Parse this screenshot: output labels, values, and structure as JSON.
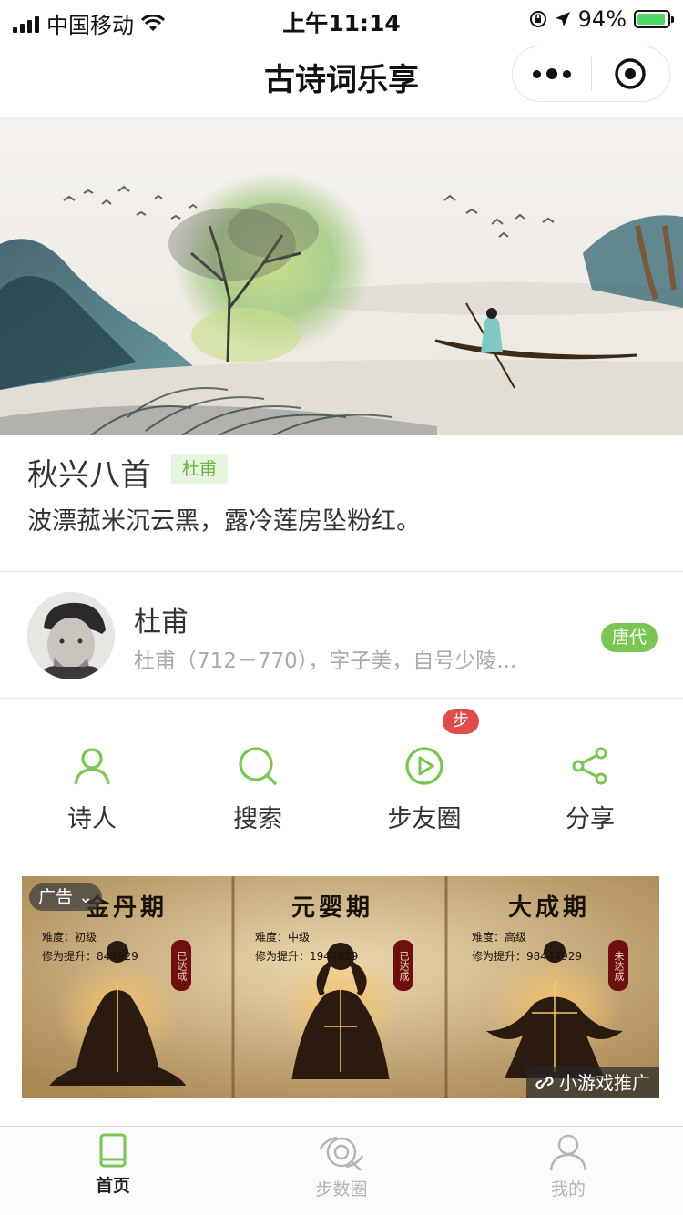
{
  "status_bar": {
    "carrier": "中国移动",
    "time": "上午11:14",
    "battery": "94%",
    "battery_level": 0.94
  },
  "nav": {
    "title": "古诗词乐享"
  },
  "poem": {
    "title": "秋兴八首",
    "author_tag": "杜甫",
    "line": "波漂菰米沉云黑，露冷莲房坠粉红。"
  },
  "poet": {
    "name": "杜甫",
    "bio": "杜甫（712－770），字子美，自号少陵...",
    "dynasty": "唐代"
  },
  "menu": {
    "items": [
      {
        "label": "诗人",
        "icon": "person-icon"
      },
      {
        "label": "搜索",
        "icon": "search-icon"
      },
      {
        "label": "步友圈",
        "icon": "play-icon"
      },
      {
        "label": "分享",
        "icon": "share-icon"
      }
    ],
    "badge": "步"
  },
  "ad": {
    "tag": "广告",
    "promo": "小游戏推广",
    "panels": [
      {
        "title": "金丹期",
        "difficulty": "难度：初级",
        "boost": "修为提升：844929",
        "seal": "已达成"
      },
      {
        "title": "元婴期",
        "difficulty": "难度：中级",
        "boost": "修为提升：1944929",
        "seal": "已达成"
      },
      {
        "title": "大成期",
        "difficulty": "难度：高级",
        "boost": "修为提升：98444929",
        "seal": "未达成"
      }
    ]
  },
  "tabbar": {
    "items": [
      {
        "label": "首页",
        "icon": "book-icon",
        "active": true
      },
      {
        "label": "步数圈",
        "icon": "steps-circle-icon",
        "active": false
      },
      {
        "label": "我的",
        "icon": "user-icon",
        "active": false
      }
    ]
  },
  "colors": {
    "accent": "#7bc552",
    "badge_red": "#e04b4b",
    "tab_inactive": "#b5b5b5"
  }
}
